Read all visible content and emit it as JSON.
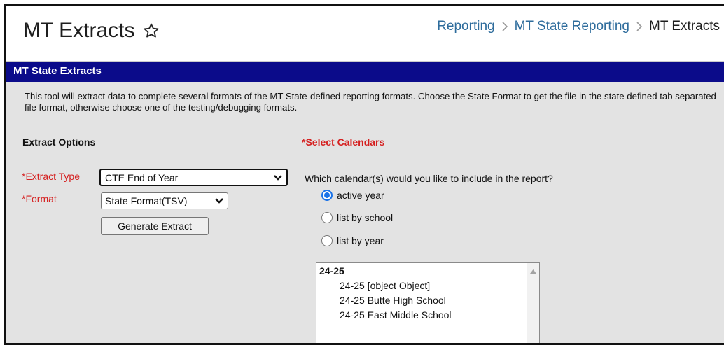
{
  "header": {
    "title": "MT Extracts",
    "breadcrumb": [
      "Reporting",
      "MT State Reporting",
      "MT Extracts"
    ]
  },
  "section": {
    "title": "MT State Extracts",
    "description": "This tool will extract data to complete several formats of the MT State-defined reporting formats. Choose the State Format to get the file in the state defined tab separated file format, otherwise choose one of the testing/debugging formats."
  },
  "extract_options": {
    "heading": "Extract Options",
    "extract_type_label": "*Extract Type",
    "extract_type_value": "CTE End of Year",
    "format_label": "*Format",
    "format_value": "State Format(TSV)",
    "generate_button": "Generate Extract"
  },
  "calendars": {
    "heading": "*Select Calendars",
    "question": "Which calendar(s) would you like to include in the report?",
    "options": [
      {
        "label": "active year",
        "checked": true
      },
      {
        "label": "list by school",
        "checked": false
      },
      {
        "label": "list by year",
        "checked": false
      }
    ],
    "list": {
      "group": "24-25",
      "items": [
        "24-25 [object Object]",
        "24-25 Butte High School",
        "24-25 East Middle School"
      ]
    }
  },
  "colors": {
    "section_header_bg": "#0b0b8a",
    "required_label": "#d52020",
    "link": "#2e6c9c",
    "radio_checked": "#1a73e8"
  },
  "icons": {
    "favorite": "star-outline-icon",
    "breadcrumb_separator": "chevron-right-icon",
    "select_arrow": "chevron-down-icon",
    "scroll_up": "triangle-up-icon"
  }
}
